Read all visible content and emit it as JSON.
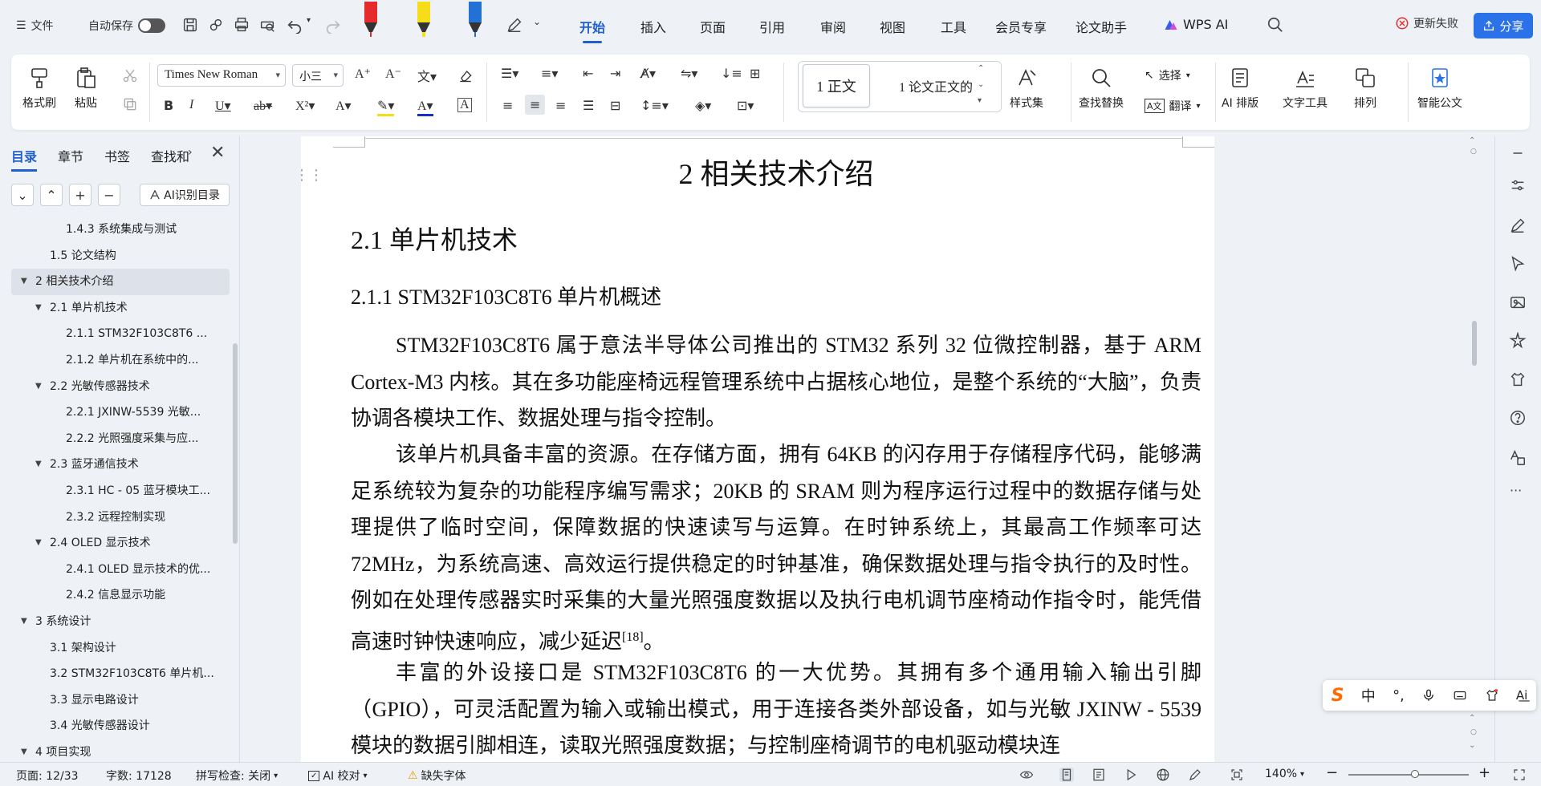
{
  "topbar": {
    "menu_label": "文件",
    "autosave_label": "自动保存",
    "tabs": [
      "开始",
      "插入",
      "页面",
      "引用",
      "审阅",
      "视图",
      "工具",
      "会员专享",
      "论文助手",
      "WPS AI"
    ],
    "update_label": "更新失败",
    "share_label": "分享"
  },
  "ribbon": {
    "format_painter": "格式刷",
    "paste": "粘贴",
    "font_name": "Times New Roman",
    "font_size": "小三",
    "style_normal": "1 正文",
    "style_body": "1 论文正文的",
    "style_set": "样式集",
    "find_replace": "查找替换",
    "select": "选择",
    "translate": "翻译",
    "ai_layout": "AI 排版",
    "text_tools": "文字工具",
    "arrange": "排列",
    "smart_doc": "智能公文"
  },
  "leftpane": {
    "tabs": [
      "目录",
      "章节",
      "书签",
      "查找和"
    ],
    "ai_toc_label": "AI识别目录",
    "toc": [
      {
        "text": "1.4.3 系统集成与测试",
        "level": 3,
        "arrow": false,
        "sel": false
      },
      {
        "text": "1.5 论文结构",
        "level": 2,
        "arrow": false,
        "sel": false
      },
      {
        "text": "2 相关技术介绍",
        "level": 1,
        "arrow": true,
        "sel": true
      },
      {
        "text": "2.1 单片机技术",
        "level": 2,
        "arrow": true,
        "sel": false
      },
      {
        "text": "2.1.1 STM32F103C8T6 ...",
        "level": 3,
        "arrow": false,
        "sel": false
      },
      {
        "text": "2.1.2 单片机在系统中的...",
        "level": 3,
        "arrow": false,
        "sel": false
      },
      {
        "text": "2.2 光敏传感器技术",
        "level": 2,
        "arrow": true,
        "sel": false
      },
      {
        "text": "2.2.1 JXINW-5539 光敏...",
        "level": 3,
        "arrow": false,
        "sel": false
      },
      {
        "text": "2.2.2 光照强度采集与应...",
        "level": 3,
        "arrow": false,
        "sel": false
      },
      {
        "text": "2.3 蓝牙通信技术",
        "level": 2,
        "arrow": true,
        "sel": false
      },
      {
        "text": "2.3.1 HC - 05 蓝牙模块工...",
        "level": 3,
        "arrow": false,
        "sel": false
      },
      {
        "text": "2.3.2 远程控制实现",
        "level": 3,
        "arrow": false,
        "sel": false
      },
      {
        "text": "2.4 OLED 显示技术",
        "level": 2,
        "arrow": true,
        "sel": false
      },
      {
        "text": "2.4.1 OLED 显示技术的优...",
        "level": 3,
        "arrow": false,
        "sel": false
      },
      {
        "text": "2.4.2 信息显示功能",
        "level": 3,
        "arrow": false,
        "sel": false
      },
      {
        "text": "3 系统设计",
        "level": 1,
        "arrow": true,
        "sel": false
      },
      {
        "text": "3.1 架构设计",
        "level": 2,
        "arrow": false,
        "sel": false
      },
      {
        "text": "3.2 STM32F103C8T6 单片机...",
        "level": 2,
        "arrow": false,
        "sel": false
      },
      {
        "text": "3.3 显示电路设计",
        "level": 2,
        "arrow": false,
        "sel": false
      },
      {
        "text": "3.4 光敏传感器设计",
        "level": 2,
        "arrow": false,
        "sel": false
      },
      {
        "text": "4 项目实现",
        "level": 1,
        "arrow": true,
        "sel": false
      }
    ]
  },
  "doc": {
    "h1": "2 相关技术介绍",
    "h2": "2.1 单片机技术",
    "h3": "2.1.1 STM32F103C8T6 单片机概述",
    "p1": "STM32F103C8T6 属于意法半导体公司推出的 STM32 系列 32 位微控制器，基于 ARM Cortex-M3 内核。其在多功能座椅远程管理系统中占据核心地位，是整个系统的“大脑”，负责协调各模块工作、数据处理与指令控制。",
    "p2": "该单片机具备丰富的资源。在存储方面，拥有 64KB 的闪存用于存储程序代码，能够满足系统较为复杂的功能程序编写需求；20KB 的 SRAM 则为程序运行过程中的数据存储与处理提供了临时空间，保障数据的快速读写与运算。在时钟系统上，其最高工作频率可达 72MHz，为系统高速、高效运行提供稳定的时钟基准，确保数据处理与指令执行的及时性。例如在处理传感器实时采集的大量光照强度数据以及执行电机调节座椅动作指令时，能凭借高速时钟快速响应，减少延迟",
    "p2_ref": "[18]",
    "p2_end": "。",
    "p3": "丰富的外设接口是 STM32F103C8T6 的一大优势。其拥有多个通用输入输出引脚（GPIO），可灵活配置为输入或输出模式，用于连接各类外部设备，如与光敏 JXINW - 5539 模块的数据引脚相连，读取光照强度数据；与控制座椅调节的电机驱动模块连"
  },
  "ime": {
    "logo": "S",
    "lang": "中",
    "punct": "°,"
  },
  "status": {
    "page": "页面: 12/33",
    "words": "字数: 17128",
    "spell": "拼写检查: 关闭",
    "ai_check": "AI 校对",
    "missing_font": "缺失字体",
    "zoom": "140%"
  },
  "colors": {
    "accent": "#1f5fcf",
    "share": "#2b72e8"
  }
}
